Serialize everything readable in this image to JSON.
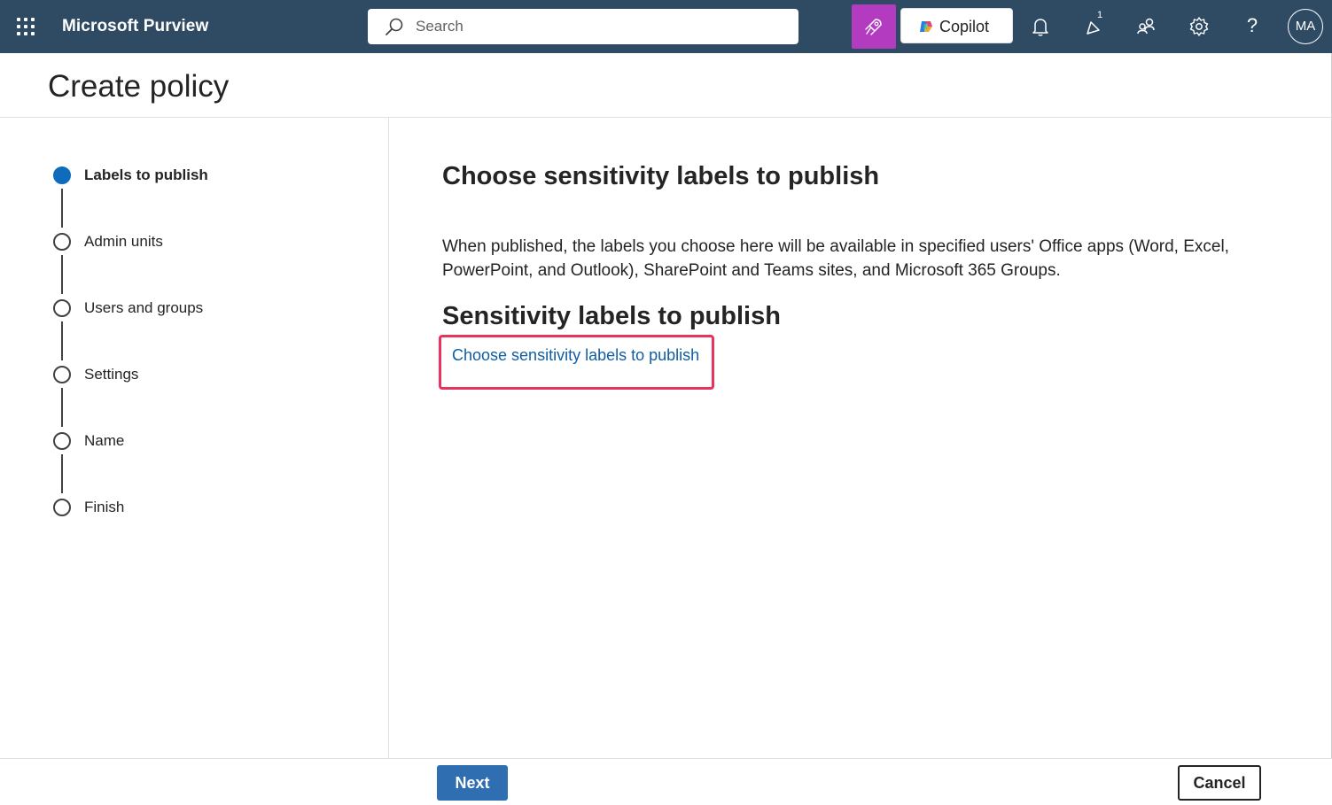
{
  "header": {
    "app_name": "Microsoft Purview",
    "search_placeholder": "Search",
    "copilot_label": "Copilot",
    "notification_badge": "1",
    "help_label": "?",
    "avatar_initials": "MA",
    "colors": {
      "bar": "#2f4a63",
      "rocket_button": "#b23bc0"
    }
  },
  "page": {
    "title": "Create policy"
  },
  "stepper": {
    "steps": [
      {
        "label": "Labels to publish",
        "state": "current"
      },
      {
        "label": "Admin units",
        "state": "pending"
      },
      {
        "label": "Users and groups",
        "state": "pending"
      },
      {
        "label": "Settings",
        "state": "pending"
      },
      {
        "label": "Name",
        "state": "pending"
      },
      {
        "label": "Finish",
        "state": "pending"
      }
    ]
  },
  "main": {
    "heading": "Choose sensitivity labels to publish",
    "description": "When published, the labels you choose here will be available in specified users' Office apps (Word, Excel, PowerPoint, and Outlook), SharePoint and Teams sites, and Microsoft 365 Groups.",
    "section_heading": "Sensitivity labels to publish",
    "choose_link": "Choose sensitivity labels to publish",
    "highlight_color": "#e8335f"
  },
  "footer": {
    "next_label": "Next",
    "cancel_label": "Cancel"
  }
}
